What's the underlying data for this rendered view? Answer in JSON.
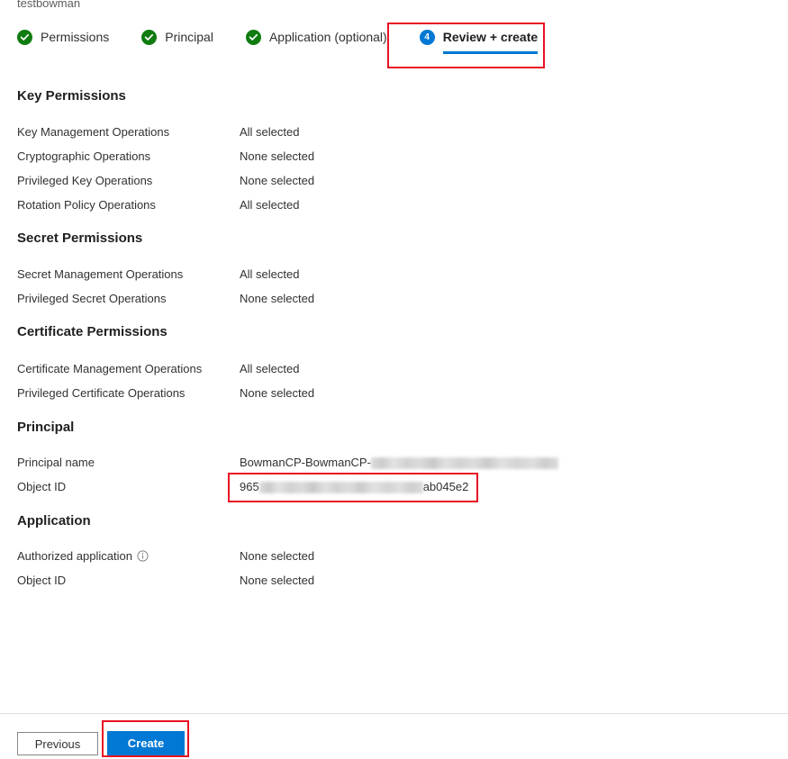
{
  "resource": {
    "name": "testbowman"
  },
  "wizard": {
    "tabs": [
      {
        "label": "Permissions",
        "badge": "check",
        "state": "done"
      },
      {
        "label": "Principal",
        "badge": "check",
        "state": "done"
      },
      {
        "label": "Application (optional)",
        "badge": "check",
        "state": "done"
      },
      {
        "label": "Review + create",
        "badge": "4",
        "state": "current"
      }
    ]
  },
  "sections": [
    {
      "title": "Key Permissions",
      "rows": [
        {
          "label": "Key Management Operations",
          "value": "All selected"
        },
        {
          "label": "Cryptographic Operations",
          "value": "None selected"
        },
        {
          "label": "Privileged Key Operations",
          "value": "None selected"
        },
        {
          "label": "Rotation Policy Operations",
          "value": "All selected"
        }
      ]
    },
    {
      "title": "Secret Permissions",
      "rows": [
        {
          "label": "Secret Management Operations",
          "value": "All selected"
        },
        {
          "label": "Privileged Secret Operations",
          "value": "None selected"
        }
      ]
    },
    {
      "title": "Certificate Permissions",
      "rows": [
        {
          "label": "Certificate Management Operations",
          "value": "All selected"
        },
        {
          "label": "Privileged Certificate Operations",
          "value": "None selected"
        }
      ]
    },
    {
      "title": "Principal",
      "rows": [
        {
          "label": "Principal name",
          "value_prefix": "BowmanCP-BowmanCP-",
          "value_suffix": "",
          "redacted": true
        },
        {
          "label": "Object ID",
          "value_prefix": "965",
          "value_suffix": "ab045e2",
          "redacted": true
        }
      ]
    },
    {
      "title": "Application",
      "rows": [
        {
          "label": "Authorized application",
          "value": "None selected",
          "info": true
        },
        {
          "label": "Object ID",
          "value": "None selected"
        }
      ]
    }
  ],
  "footer": {
    "previous_label": "Previous",
    "create_label": "Create"
  },
  "colors": {
    "accent_blue": "#0078d4",
    "success_green": "#107c10",
    "annotation_red": "#e81123"
  }
}
